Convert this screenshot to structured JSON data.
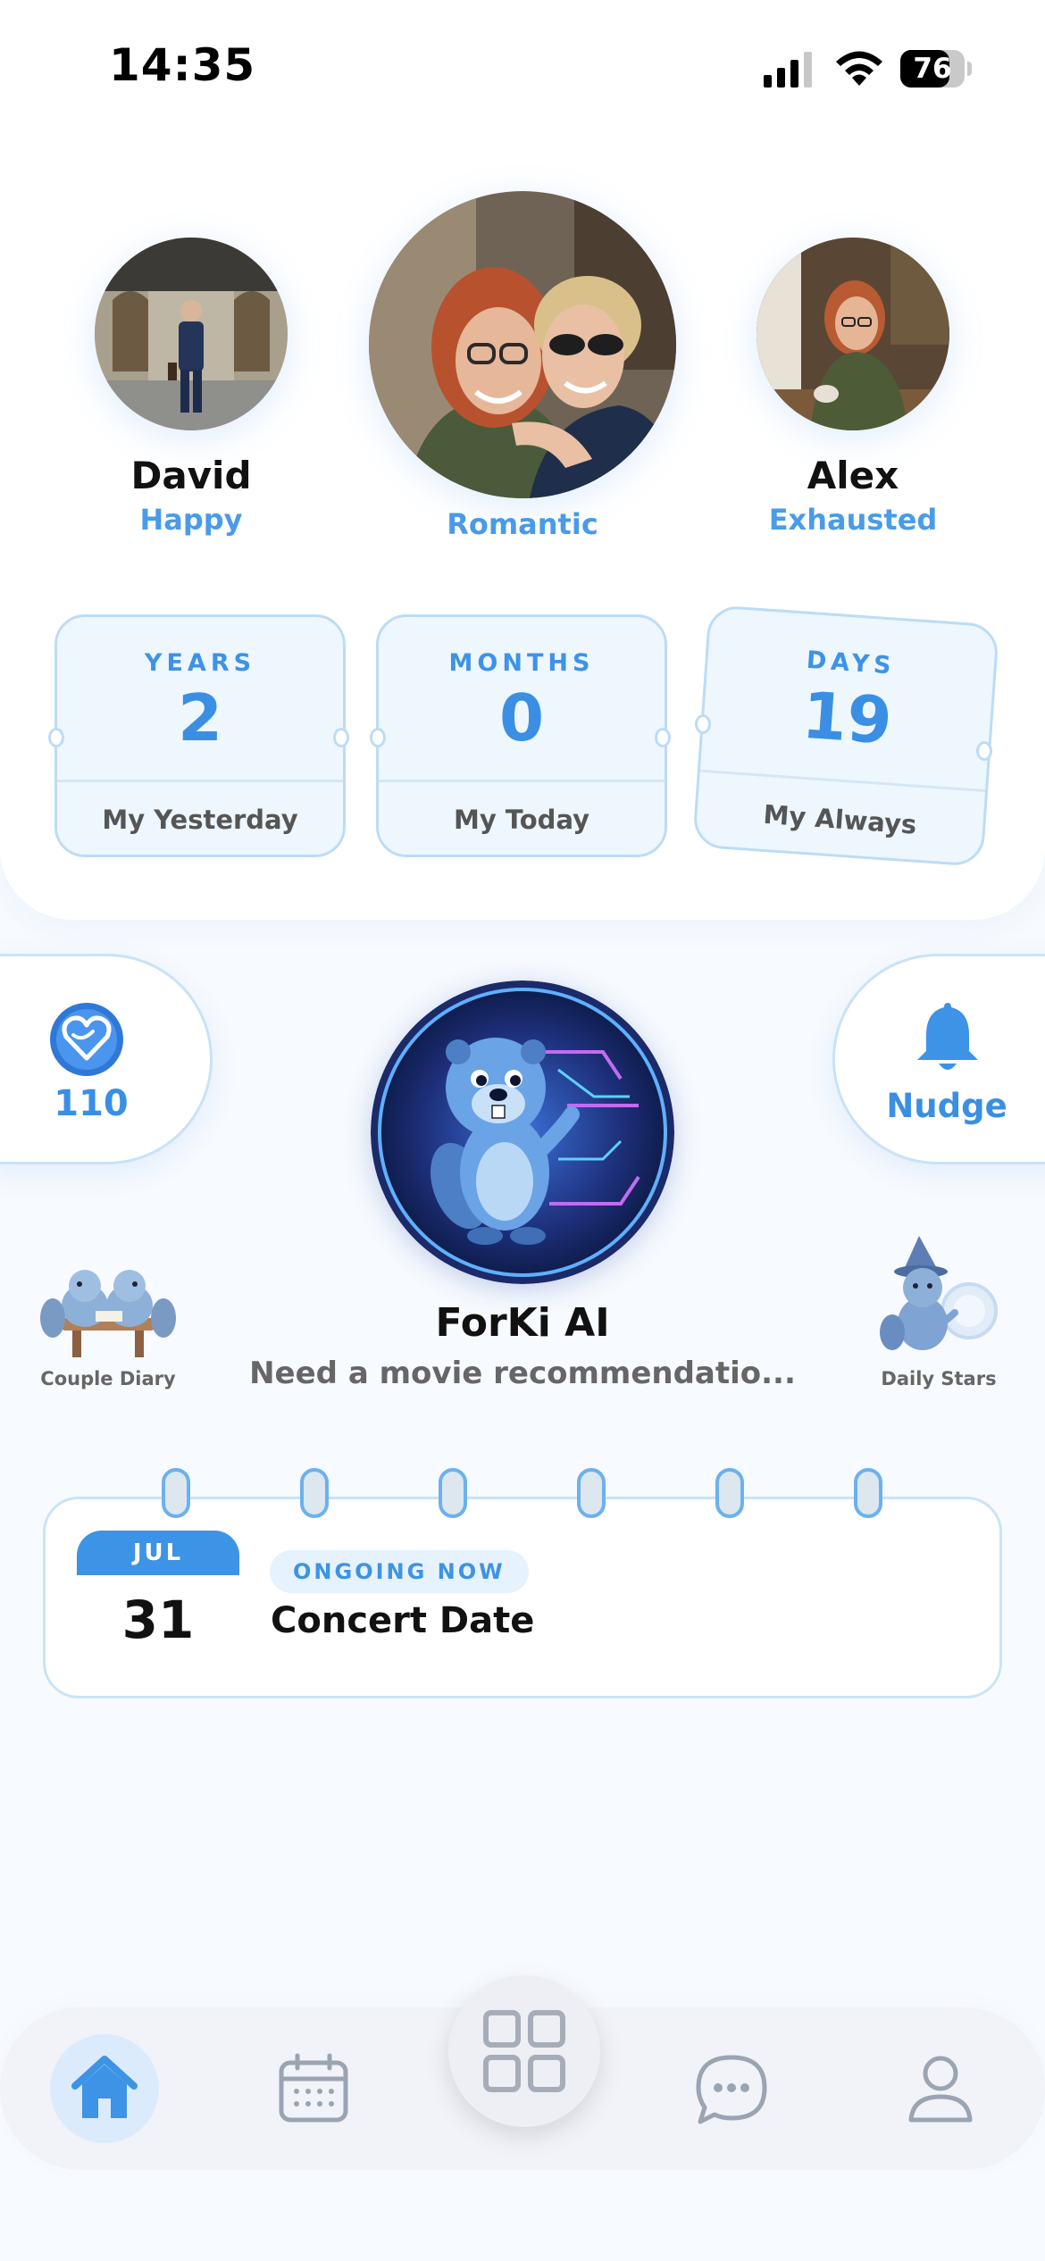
{
  "status_bar": {
    "time": "14:35",
    "battery": "76",
    "battery_level": 0.76
  },
  "profiles": {
    "left": {
      "name": "David",
      "mood": "Happy"
    },
    "center": {
      "mood": "Romantic"
    },
    "right": {
      "name": "Alex",
      "mood": "Exhausted"
    }
  },
  "counters": [
    {
      "unit": "YEARS",
      "value": "2",
      "label": "My Yesterday"
    },
    {
      "unit": "MONTHS",
      "value": "0",
      "label": "My Today"
    },
    {
      "unit": "DAYS",
      "value": "19",
      "label": "My Always"
    }
  ],
  "side_pills": {
    "points": {
      "value": "110",
      "icon": "heart-badge-icon"
    },
    "nudge": {
      "label": "Nudge",
      "icon": "bell-icon"
    }
  },
  "assistant": {
    "title": "ForKi AI",
    "subtitle": "Need a movie recommendatio..."
  },
  "features": {
    "left": {
      "label": "Couple Diary"
    },
    "right": {
      "label": "Daily Stars"
    }
  },
  "event": {
    "month": "JUL",
    "day": "31",
    "status": "ONGOING NOW",
    "title": "Concert Date"
  },
  "tab_bar": {
    "items": [
      "home-icon",
      "calendar-icon",
      "grid-icon",
      "chat-icon",
      "profile-icon"
    ],
    "active": "home-icon"
  },
  "colors": {
    "accent": "#3a8fe4",
    "accent_light": "#eef6fe"
  }
}
